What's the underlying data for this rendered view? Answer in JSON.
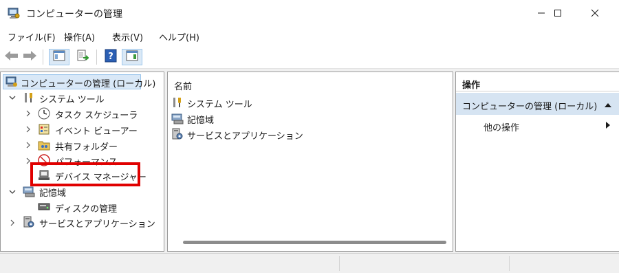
{
  "window": {
    "title": "コンピューターの管理",
    "app_icon": "computer-management-icon",
    "controls": [
      "minimize-icon",
      "maximize-icon",
      "close-icon"
    ]
  },
  "menu": [
    "ファイル(F)",
    "操作(A)",
    "表示(V)",
    "ヘルプ(H)"
  ],
  "toolbar": {
    "buttons": [
      "back-arrow-icon",
      "forward-arrow-icon",
      "console-tree-icon",
      "export-list-icon",
      "help-icon",
      "action-pane-icon"
    ]
  },
  "tree": {
    "root": "コンピューターの管理 (ローカル)",
    "items": [
      {
        "label": "システム ツール",
        "icon": "tools-icon",
        "expanded": true
      },
      {
        "label": "タスク スケジューラ",
        "icon": "clock-icon"
      },
      {
        "label": "イベント ビューアー",
        "icon": "event-viewer-icon"
      },
      {
        "label": "共有フォルダー",
        "icon": "shared-folder-icon"
      },
      {
        "label": "パフォーマンス",
        "icon": "performance-icon"
      },
      {
        "label": "デバイス マネージャー",
        "icon": "device-manager-icon",
        "highlighted": true
      },
      {
        "label": "記憶域",
        "icon": "storage-icon",
        "expanded": true
      },
      {
        "label": "ディスクの管理",
        "icon": "disk-management-icon"
      },
      {
        "label": "サービスとアプリケーション",
        "icon": "services-icon",
        "expanded": false
      }
    ]
  },
  "center": {
    "column_header": "名前",
    "items": [
      {
        "label": "システム ツール",
        "icon": "tools-icon"
      },
      {
        "label": "記憶域",
        "icon": "storage-icon"
      },
      {
        "label": "サービスとアプリケーション",
        "icon": "services-icon"
      }
    ]
  },
  "actions": {
    "header": "操作",
    "group": "コンピューターの管理 (ローカル)",
    "more": "他の操作"
  },
  "colors": {
    "highlight_box": "#e00000",
    "selection": "#d9e8f7",
    "actions_group": "#d6e4f2"
  }
}
